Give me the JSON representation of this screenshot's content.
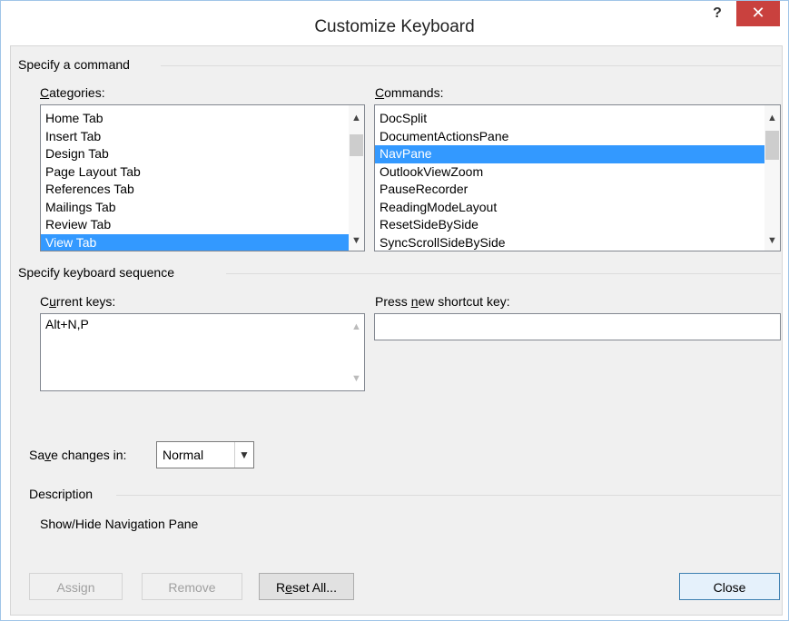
{
  "window": {
    "title": "Customize Keyboard",
    "help_label": "?",
    "close_label": "✕"
  },
  "specify_command": {
    "group_label": "Specify a command",
    "categories": {
      "label_pre": "",
      "label_u": "C",
      "label_post": "ategories:",
      "items": [
        "Home Tab",
        "Insert Tab",
        "Design Tab",
        "Page Layout Tab",
        "References Tab",
        "Mailings Tab",
        "Review Tab",
        "View Tab"
      ],
      "selected_index": 7
    },
    "commands": {
      "label_pre": "",
      "label_u": "C",
      "label_post": "ommands:",
      "items": [
        "DocSplit",
        "DocumentActionsPane",
        "NavPane",
        "OutlookViewZoom",
        "PauseRecorder",
        "ReadingModeLayout",
        "ResetSideBySide",
        "SyncScrollSideBySide"
      ],
      "selected_index": 2
    }
  },
  "keyboard_sequence": {
    "group_label": "Specify keyboard sequence",
    "current_keys": {
      "label_pre": "C",
      "label_u": "u",
      "label_post": "rrent keys:",
      "items": [
        "Alt+N,P"
      ]
    },
    "new_shortcut": {
      "label_pre": "Press ",
      "label_u": "n",
      "label_post": "ew shortcut key:",
      "value": ""
    }
  },
  "save_changes": {
    "label_pre": "Sa",
    "label_u": "v",
    "label_post": "e changes in:",
    "value": "Normal"
  },
  "description": {
    "group_label": "Description",
    "text": "Show/Hide Navigation Pane"
  },
  "buttons": {
    "assign": "Assign",
    "remove": "Remove",
    "reset_pre": "R",
    "reset_u": "e",
    "reset_post": "set All...",
    "close": "Close"
  },
  "icons": {
    "scroll_up": "chevron-up-icon",
    "scroll_down": "chevron-down-icon",
    "dropdown": "chevron-down-icon"
  },
  "colors": {
    "selection": "#3399ff",
    "close_button": "#c9413e",
    "border": "#a0c5e8"
  }
}
